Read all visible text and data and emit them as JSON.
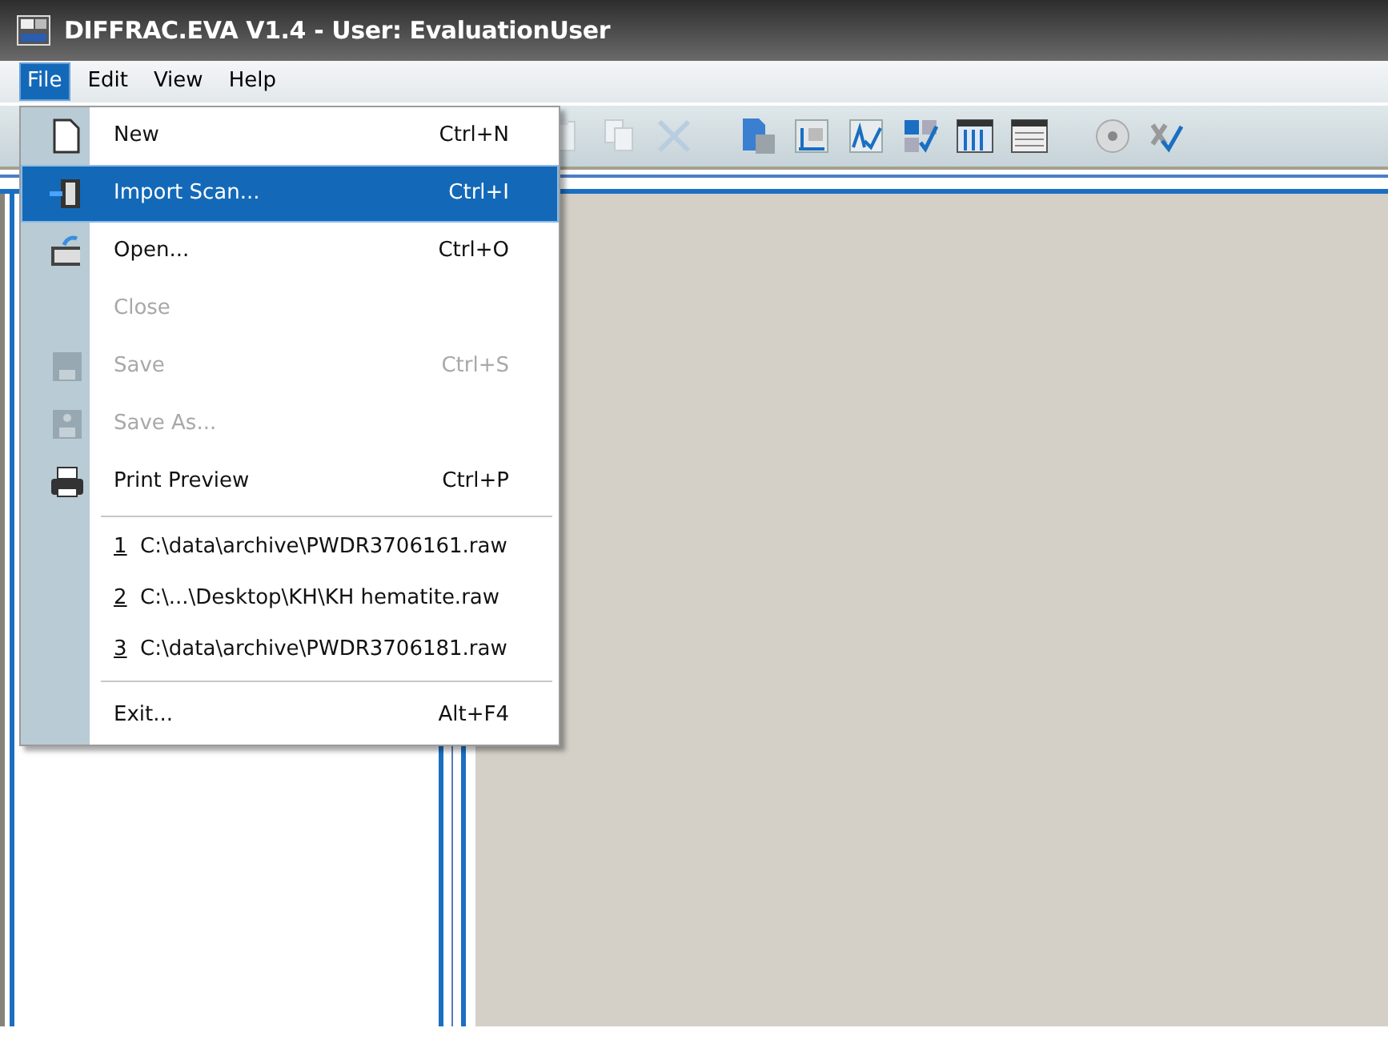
{
  "window": {
    "title": "DIFFRAC.EVA V1.4 - User: EvaluationUser"
  },
  "menu_bar": [
    {
      "label": "File",
      "selected": true
    },
    {
      "label": "Edit",
      "selected": false
    },
    {
      "label": "View",
      "selected": false
    },
    {
      "label": "Help",
      "selected": false
    }
  ],
  "file_menu": [
    {
      "kind": "command",
      "label": "New",
      "shortcut": "Ctrl+N",
      "selected": false,
      "disabled": false
    },
    {
      "kind": "command",
      "label": "Import Scan...",
      "shortcut": "Ctrl+I",
      "selected": true,
      "disabled": false
    },
    {
      "kind": "command",
      "label": "Open...",
      "shortcut": "Ctrl+O",
      "selected": false,
      "disabled": false
    },
    {
      "kind": "command",
      "label": "Close",
      "selected": false,
      "disabled": true
    },
    {
      "kind": "command",
      "label": "Save",
      "shortcut": "Ctrl+S",
      "selected": false,
      "disabled": true
    },
    {
      "kind": "command",
      "label": "Save As...",
      "selected": false,
      "disabled": true
    },
    {
      "kind": "command",
      "label": "Print Preview",
      "shortcut": "Ctrl+P",
      "selected": false,
      "disabled": false
    },
    {
      "kind": "separator"
    },
    {
      "kind": "recent",
      "number": "1",
      "label": "C:\\data\\archive\\PWDR3706161.raw",
      "selected": false,
      "disabled": false
    },
    {
      "kind": "recent",
      "number": "2",
      "label": "C:\\...\\Desktop\\KH\\KH hematite.raw",
      "selected": false,
      "disabled": false
    },
    {
      "kind": "recent",
      "number": "3",
      "label": "C:\\data\\archive\\PWDR3706181.raw",
      "selected": false,
      "disabled": false
    },
    {
      "kind": "separator"
    },
    {
      "kind": "command",
      "label": "Exit...",
      "shortcut": "Alt+F4",
      "selected": false,
      "disabled": false
    }
  ]
}
